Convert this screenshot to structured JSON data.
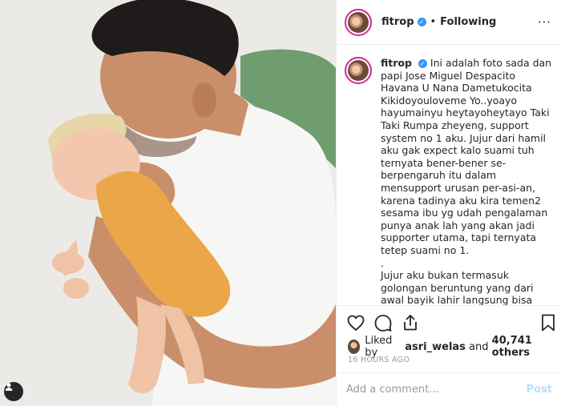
{
  "post": {
    "username": "fitrop",
    "verified_icon": "verified-badge-icon",
    "follow_status": "Following",
    "separator": "•"
  },
  "caption": {
    "username": "fitrop",
    "text": "Ini adalah foto sada dan papi Jose Miguel Despacito Havana U Nana Dametukocita Kikidoyouloveme Yo..yoayo hayumainyu heytayoheytayo Taki Taki Rumpa zheyeng, support system no 1 aku. Jujur dari hamil aku gak expect kalo suami tuh ternyata bener-bener se-berpengaruh itu dalam mensupport urusan per-asi-an, karena tadinya aku kira temen2 sesama ibu yg udah pengalaman punya anak lah yang akan jadi supporter utama, tapi ternyata tetep suami no 1.\n.\nJujur aku bukan termasuk golongan beruntung yang dari awal bayik lahir langsung bisa"
  },
  "actions": {
    "icons": [
      "heart-icon",
      "comment-icon",
      "share-icon",
      "bookmark-icon"
    ]
  },
  "likes": {
    "prefix": "Liked by",
    "user": "asri_welas",
    "conjunction": "and",
    "others": "40,741 others"
  },
  "timestamp": "16 HOURS AGO",
  "comment_box": {
    "placeholder": "Add a comment...",
    "post_label": "Post"
  },
  "colors": {
    "link_blue": "#3897f0",
    "post_disabled": "#b2dffc",
    "story_ring": "#d6249f",
    "muted_text": "#999999"
  }
}
